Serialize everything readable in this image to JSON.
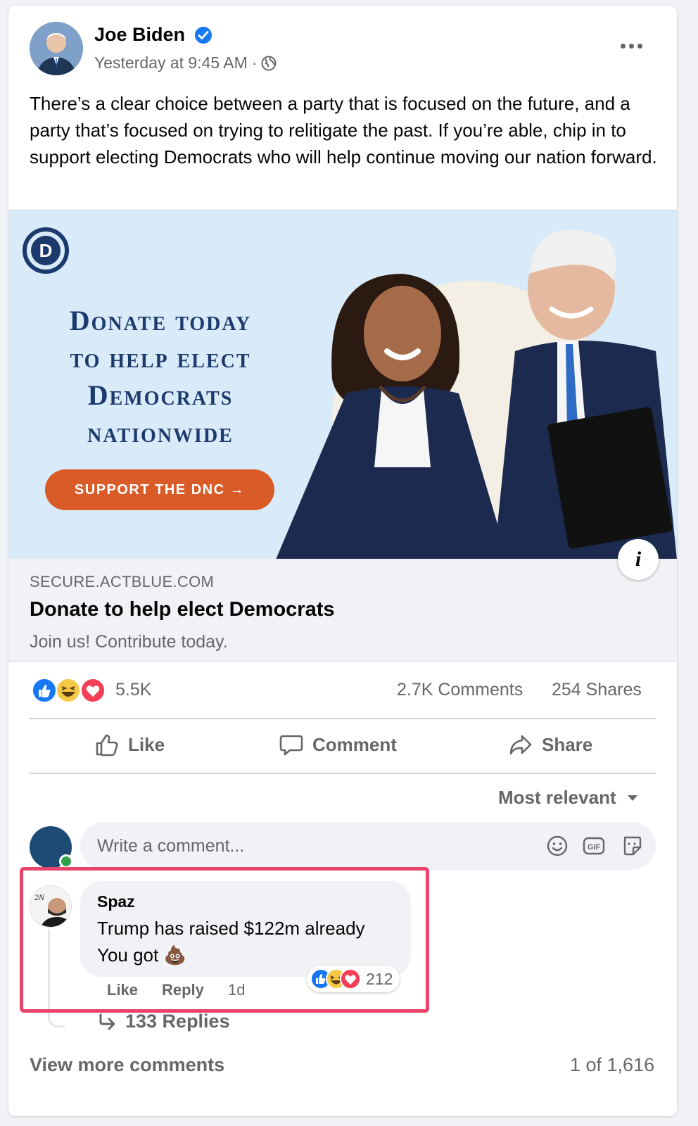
{
  "post": {
    "author": "Joe Biden",
    "timestamp": "Yesterday at 9:45 AM",
    "separator": "·",
    "privacy_icon": "globe-icon",
    "text": "There’s a clear choice between a party that is focused on the future, and a party that’s focused on trying to relitigate the past. If you’re able, chip in to support electing Democrats who will help continue moving our nation forward."
  },
  "ad": {
    "headline_lines": [
      "Donate today",
      "to help elect",
      "Democrats",
      "nationwide"
    ],
    "cta": "SUPPORT THE DNC →",
    "logo_letter": "D",
    "info_glyph": "i"
  },
  "link": {
    "domain": "SECURE.ACTBLUE.COM",
    "title": "Donate to help elect Democrats",
    "subtitle": "Join us! Contribute today."
  },
  "stats": {
    "reactions": "5.5K",
    "comments": "2.7K Comments",
    "shares": "254 Shares",
    "reaction_types": [
      "like",
      "haha",
      "love"
    ]
  },
  "actions": {
    "like": "Like",
    "comment": "Comment",
    "share": "Share"
  },
  "sort": {
    "label": "Most relevant"
  },
  "composer": {
    "placeholder": "Write a comment..."
  },
  "comment": {
    "author": "Spaz",
    "text_line1": "Trump has raised $122m already",
    "text_line2": "You got 💩",
    "reaction_count": "212",
    "like": "Like",
    "reply": "Reply",
    "time": "1d",
    "replies": "133 Replies"
  },
  "footer": {
    "view_more": "View more comments",
    "pager": "1 of 1,616"
  },
  "colors": {
    "accent": "#1877f2",
    "highlight": "#e8436b",
    "cta": "#d95b28",
    "ad_navy": "#1d3a6e"
  }
}
